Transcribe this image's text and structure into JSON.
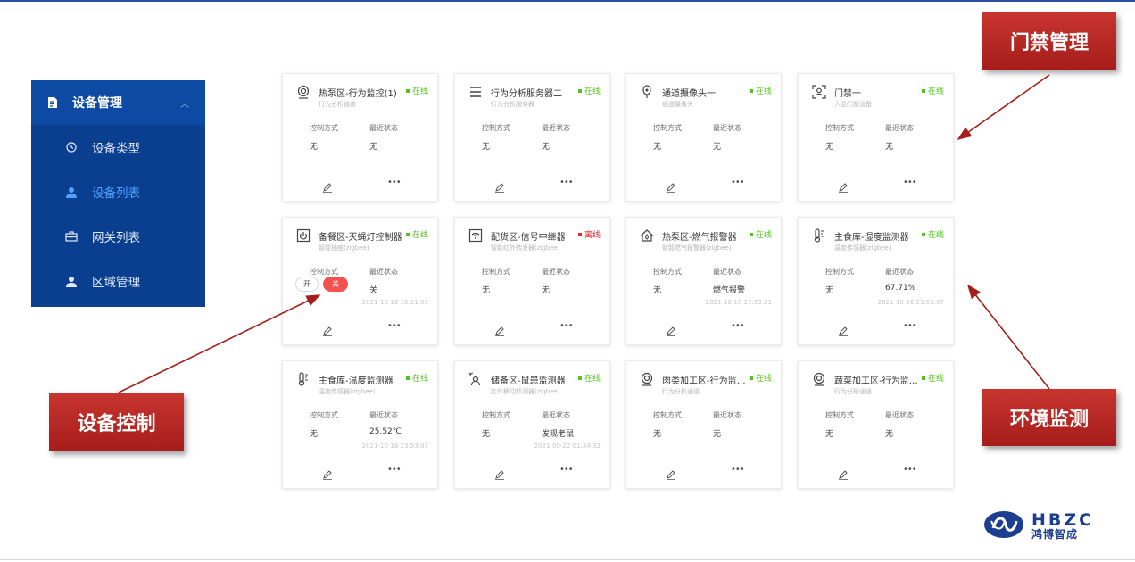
{
  "sidebar": {
    "group_label": "设备管理",
    "items": [
      {
        "label": "设备类型",
        "icon": "clock-icon",
        "active": false
      },
      {
        "label": "设备列表",
        "icon": "user-icon",
        "active": true
      },
      {
        "label": "网关列表",
        "icon": "gateway-icon",
        "active": false
      },
      {
        "label": "区域管理",
        "icon": "user-icon",
        "active": false
      }
    ]
  },
  "labels": {
    "control_method": "控制方式",
    "latest_status": "最近状态",
    "more": "•••"
  },
  "toggle": {
    "on_label": "开",
    "off_label": "关"
  },
  "cards": [
    {
      "title": "热泵区-行为监控(1)",
      "subtitle": "行为分析通道",
      "status": "在线",
      "online": true,
      "control": "无",
      "state": "无",
      "time": "",
      "icon": "camera-icon"
    },
    {
      "title": "行为分析服务器二",
      "subtitle": "行为分析服务器",
      "status": "在线",
      "online": true,
      "control": "无",
      "state": "无",
      "time": "",
      "icon": "server-icon"
    },
    {
      "title": "通道摄像头一",
      "subtitle": "通道摄像头",
      "status": "在线",
      "online": true,
      "control": "无",
      "state": "无",
      "time": "",
      "icon": "bullet-camera-icon"
    },
    {
      "title": "门禁一",
      "subtitle": "人脸门禁设备",
      "status": "在线",
      "online": true,
      "control": "无",
      "state": "无",
      "time": "",
      "icon": "face-scan-icon"
    },
    {
      "title": "备餐区-灭蝇灯控制器",
      "subtitle": "智能插座(zigbee)",
      "status": "在线",
      "online": true,
      "control": "",
      "state": "关",
      "time": "2021-10-16 18:31:09",
      "icon": "socket-icon",
      "has_toggle": true
    },
    {
      "title": "配货区-信号中继器",
      "subtitle": "智能红外转发器(zigbee)",
      "status": "离线",
      "online": false,
      "control": "无",
      "state": "无",
      "time": "",
      "icon": "wifi-icon"
    },
    {
      "title": "热泵区-燃气报警器",
      "subtitle": "智能燃气报警器(zigbee)",
      "status": "在线",
      "online": true,
      "control": "无",
      "state": "燃气报警",
      "time": "2021-10-18 17:53:21",
      "icon": "gas-alarm-icon"
    },
    {
      "title": "主食库-湿度监测器",
      "subtitle": "温度传感器(zigbee)",
      "status": "在线",
      "online": true,
      "control": "无",
      "state": "67.71%",
      "time": "2021-10-16 23:53:07",
      "icon": "thermometer-icon"
    },
    {
      "title": "主食库-温度监测器",
      "subtitle": "温度传感器(zigbee)",
      "status": "在线",
      "online": true,
      "control": "无",
      "state": "25.52℃",
      "time": "2021-10-16 23:53:07",
      "icon": "thermometer-icon"
    },
    {
      "title": "储备区-鼠患监测器",
      "subtitle": "红外移动侦测器(zigbee)",
      "status": "在线",
      "online": true,
      "control": "无",
      "state": "发现老鼠",
      "time": "2021-09-22 01:34:32",
      "icon": "motion-sensor-icon"
    },
    {
      "title": "肉类加工区-行为监控(...",
      "subtitle": "行为分析通道",
      "status": "在线",
      "online": true,
      "control": "无",
      "state": "无",
      "time": "",
      "icon": "camera-icon"
    },
    {
      "title": "蔬菜加工区-行为监控(...",
      "subtitle": "行为分析通道",
      "status": "在线",
      "online": true,
      "control": "无",
      "state": "无",
      "time": "",
      "icon": "camera-icon"
    }
  ],
  "callouts": {
    "access_control": "门禁管理",
    "device_control": "设备控制",
    "env_monitoring": "环境监测"
  },
  "logo": {
    "brand": "HBZC",
    "name_cn": "鸿博智成"
  },
  "colors": {
    "sidebar_bg": "#0a3f8f",
    "online": "#52c41a",
    "offline": "#f5222d",
    "callout": "#b72823",
    "accent": "#4fa3ff"
  }
}
